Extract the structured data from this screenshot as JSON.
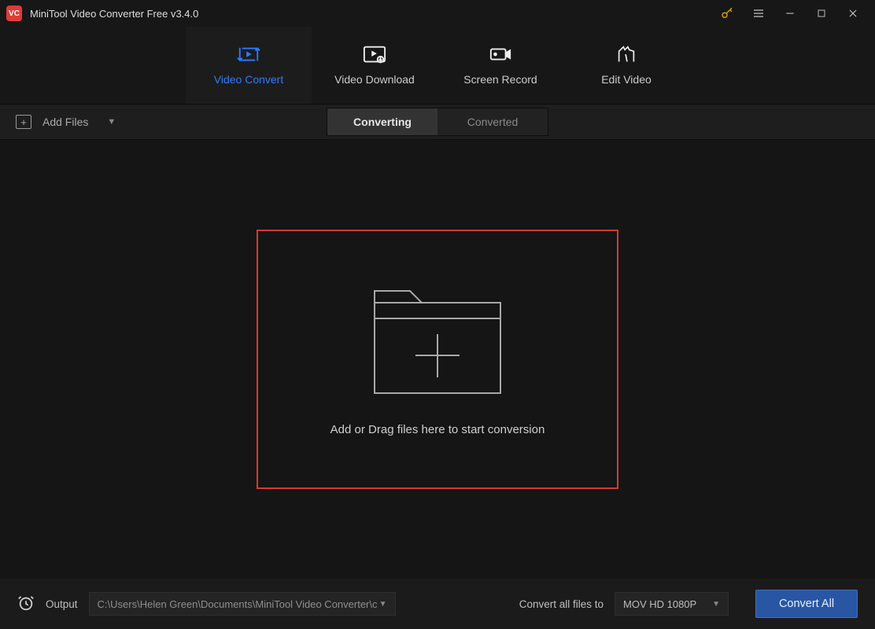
{
  "titlebar": {
    "app_title": "MiniTool Video Converter Free v3.4.0",
    "logo_text": "VC"
  },
  "nav": {
    "tabs": [
      {
        "label": "Video Convert",
        "active": true
      },
      {
        "label": "Video Download",
        "active": false
      },
      {
        "label": "Screen Record",
        "active": false
      },
      {
        "label": "Edit Video",
        "active": false
      }
    ]
  },
  "toolbar": {
    "add_files_label": "Add Files",
    "segments": {
      "converting": "Converting",
      "converted": "Converted"
    }
  },
  "dropzone": {
    "hint": "Add or Drag files here to start conversion"
  },
  "footer": {
    "output_label": "Output",
    "output_path": "C:\\Users\\Helen Green\\Documents\\MiniTool Video Converter\\c",
    "convert_all_label": "Convert all files to",
    "target_format": "MOV HD 1080P",
    "convert_button": "Convert All"
  }
}
